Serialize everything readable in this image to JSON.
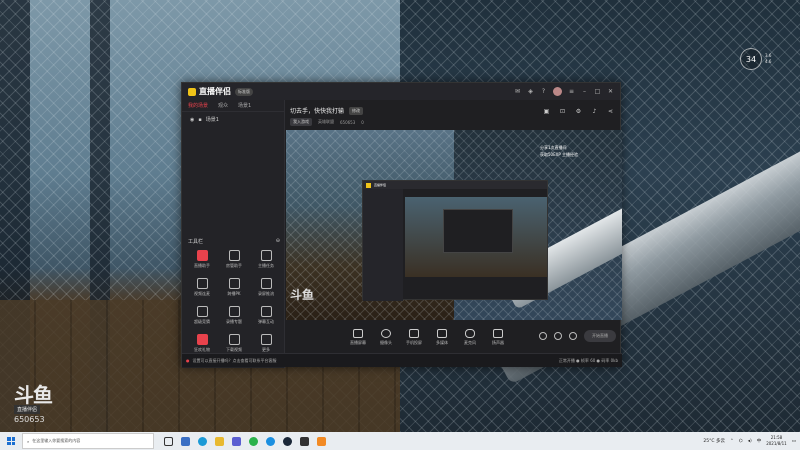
{
  "desktop": {
    "watermark": {
      "logo": "斗鱼",
      "tag": "直播伴侣",
      "room_id": "650653"
    },
    "weather": {
      "temp": "34",
      "line1": "3.6",
      "line2": "4.6"
    }
  },
  "app": {
    "title": "直播伴侣",
    "version_badge": "标准版",
    "sidebar": {
      "tabs": [
        "我的场景",
        "观众",
        "场景1"
      ],
      "scene_item": "场景1",
      "tools_title": "工具栏",
      "tools": [
        "直播助手",
        "房管助手",
        "主播任务",
        "视频连麦",
        "跨播PK",
        "录屏推流",
        "超级竞猜",
        "录播专题",
        "弹幕互动",
        "狂欢礼物",
        "下载视频",
        "更多"
      ]
    },
    "content": {
      "live_title": "切去手，快快我打输",
      "edit_label": "修改",
      "category": "我入游戏",
      "category_label": "英雄联盟",
      "room_num": "650653",
      "viewers": "0"
    },
    "preview": {
      "overlay_line1": "分享1次直播间",
      "overlay_line2": "获取50EXP 主播经验",
      "nested_title": "直播伴侣",
      "wm": "斗鱼"
    },
    "controls": [
      "直播屏幕",
      "摄像头",
      "手机投屏",
      "多媒体",
      "麦克风",
      "扬声器"
    ],
    "start_button": "开始直播",
    "status": {
      "warning": "设置可以直接开播吗？点击查看可联系平台客服",
      "right": "正常开播 ● 帧率 60 ● 码率 0kb"
    }
  },
  "taskbar": {
    "search_placeholder": "在这里输入你要搜索的内容",
    "weather": "25°C 多云",
    "ime": "中",
    "time": "21:58",
    "date": "2021/8/11"
  },
  "colors": {
    "accent": "#e8424c",
    "brand_yellow": "#f0c419"
  }
}
